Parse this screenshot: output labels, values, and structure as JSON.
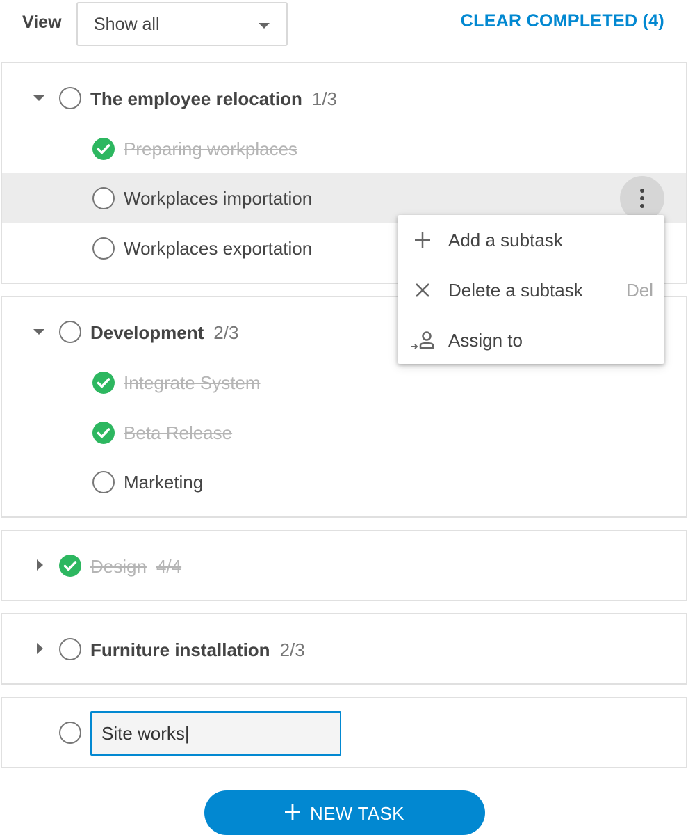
{
  "toolbar": {
    "view_label": "View",
    "view_select_value": "Show all",
    "clear_completed": "CLEAR COMPLETED (4)"
  },
  "tasks": [
    {
      "title": "The employee relocation",
      "count": "1/3",
      "expanded": true,
      "completed": false,
      "subtasks": [
        {
          "label": "Preparing workplaces",
          "completed": true
        },
        {
          "label": "Workplaces importation",
          "completed": false,
          "highlighted": true
        },
        {
          "label": "Workplaces exportation",
          "completed": false
        }
      ]
    },
    {
      "title": "Development",
      "count": "2/3",
      "expanded": true,
      "completed": false,
      "subtasks": [
        {
          "label": "Integrate System",
          "completed": true
        },
        {
          "label": "Beta Release",
          "completed": true
        },
        {
          "label": "Marketing",
          "completed": false
        }
      ]
    },
    {
      "title": "Design",
      "count": "4/4",
      "expanded": false,
      "completed": true
    },
    {
      "title": "Furniture installation",
      "count": "2/3",
      "expanded": false,
      "completed": false
    }
  ],
  "context_menu": {
    "items": [
      {
        "label": "Add a subtask",
        "icon": "plus-icon",
        "shortcut": ""
      },
      {
        "label": "Delete a subtask",
        "icon": "close-icon",
        "shortcut": "Del"
      },
      {
        "label": "Assign to",
        "icon": "assign-user-icon",
        "shortcut": ""
      }
    ]
  },
  "new_task_input": {
    "value": "Site works|"
  },
  "new_task_button": {
    "label": "NEW TASK"
  },
  "colors": {
    "accent": "#0288d1",
    "completed_check": "#2db760",
    "highlight_row": "#ececec"
  }
}
